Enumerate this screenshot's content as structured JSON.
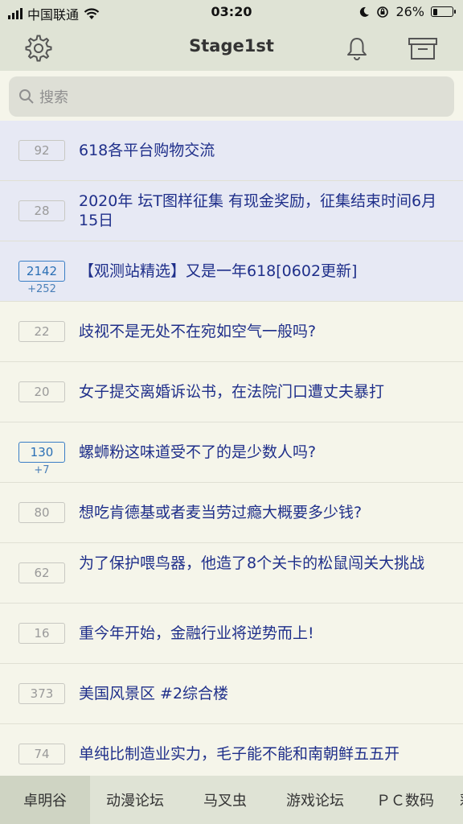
{
  "status_bar": {
    "carrier": "中国联通",
    "time": "03:20",
    "battery": "26%",
    "battery_level": 0.26
  },
  "nav": {
    "title": "Stage1st",
    "left_icon": "gear-icon",
    "right_icons": [
      "bell-icon",
      "archive-icon"
    ]
  },
  "search": {
    "placeholder": "搜索"
  },
  "threads": [
    {
      "count": "92",
      "delta": "",
      "title": "618各平台购物交流",
      "pinned": true,
      "hot": false
    },
    {
      "count": "28",
      "delta": "",
      "title": "2020年 坛T图样征集 有现金奖励，征集结束时间6月15日",
      "pinned": true,
      "hot": false
    },
    {
      "count": "2142",
      "delta": "+252",
      "title": "【观测站精选】又是一年618[0602更新]",
      "pinned": true,
      "hot": true
    },
    {
      "count": "22",
      "delta": "",
      "title": "歧视不是无处不在宛如空气一般吗?",
      "pinned": false,
      "hot": false
    },
    {
      "count": "20",
      "delta": "",
      "title": "女子提交离婚诉讼书，在法院门口遭丈夫暴打",
      "pinned": false,
      "hot": false
    },
    {
      "count": "130",
      "delta": "+7",
      "title": "螺蛳粉这味道受不了的是少数人吗?",
      "pinned": false,
      "hot": true
    },
    {
      "count": "80",
      "delta": "",
      "title": "想吃肯德基或者麦当劳过瘾大概要多少钱?",
      "pinned": false,
      "hot": false
    },
    {
      "count": "62",
      "delta": "",
      "title": "为了保护喂鸟器，他造了8个关卡的松鼠闯关大挑战",
      "pinned": false,
      "hot": false
    },
    {
      "count": "16",
      "delta": "",
      "title": "重今年开始，金融行业将逆势而上!",
      "pinned": false,
      "hot": false
    },
    {
      "count": "373",
      "delta": "",
      "title": "美国风景区 #2综合楼",
      "pinned": false,
      "hot": false
    },
    {
      "count": "74",
      "delta": "",
      "title": "单纯比制造业实力，毛子能不能和南朝鲜五五开",
      "pinned": false,
      "hot": false
    }
  ],
  "tabs": [
    "卓明谷",
    "动漫论坛",
    "马叉虫",
    "游戏论坛",
    "ＰＣ数码",
    "彩"
  ],
  "active_tab": 0,
  "colors": {
    "bar_bg": "#dfe3d5",
    "page_bg": "#f5f5ea",
    "pinned_bg": "#e7e9f4",
    "title_text": "#1f2f8a",
    "hot_badge": "#2a6fb5"
  }
}
